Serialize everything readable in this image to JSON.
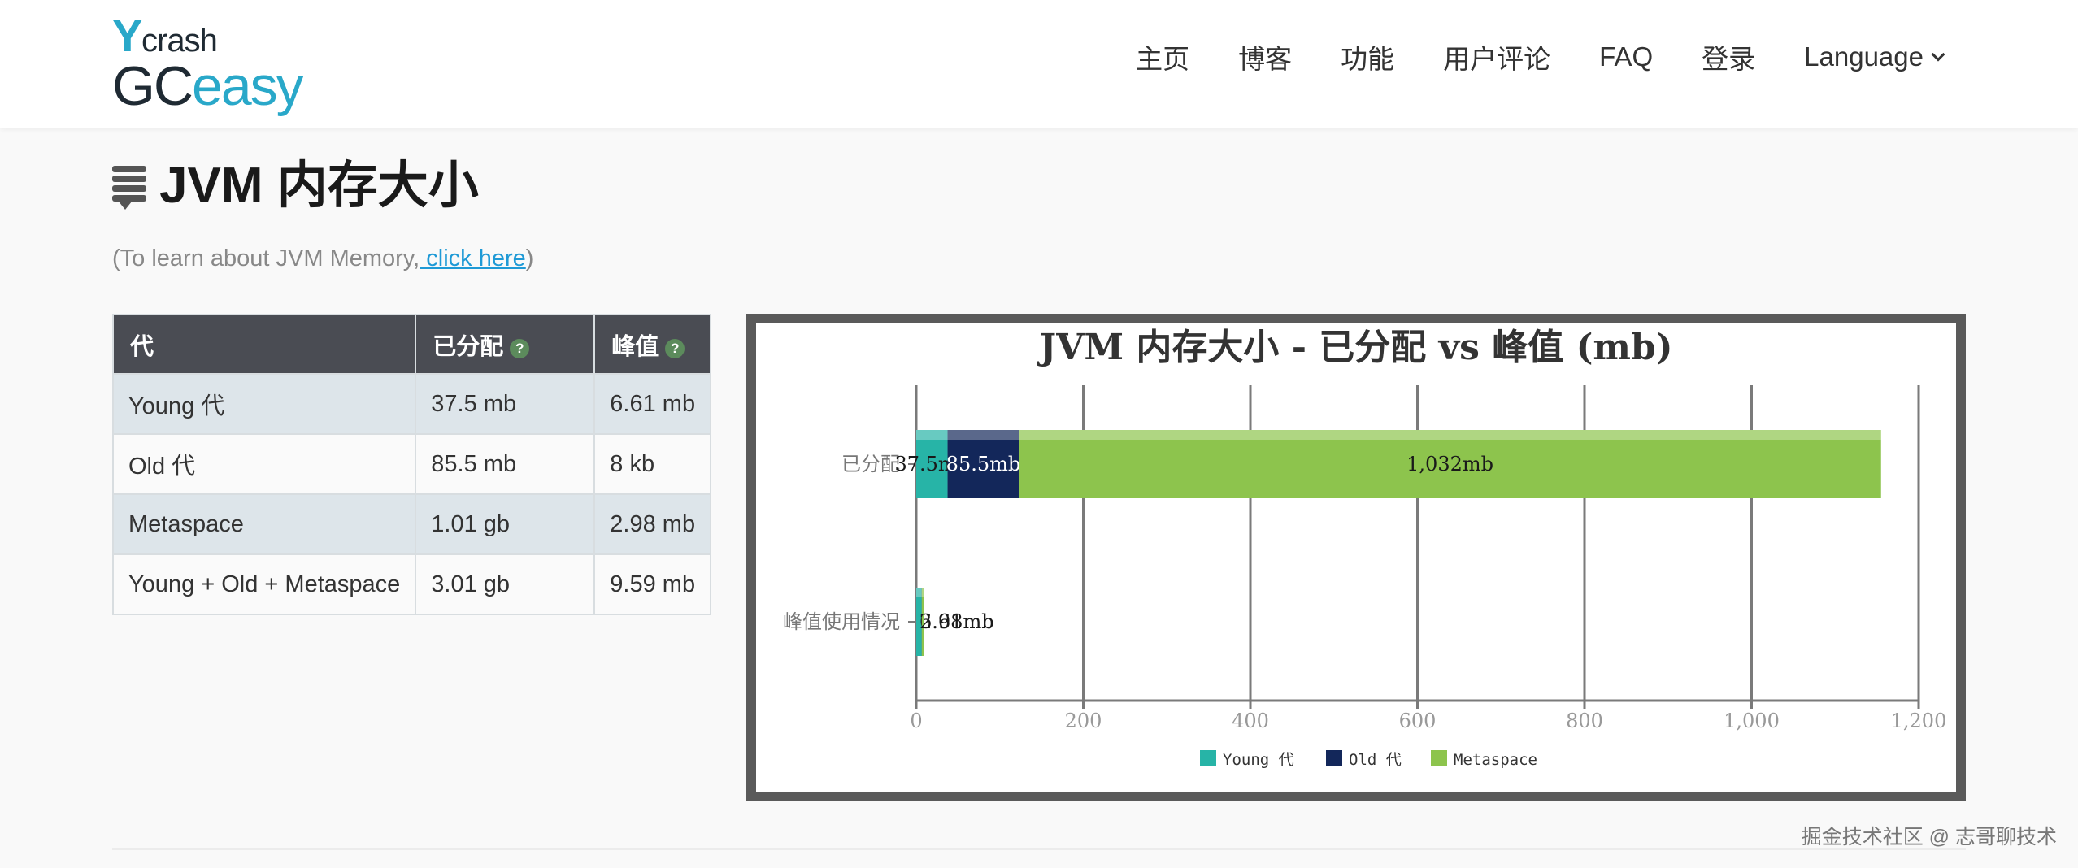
{
  "header": {
    "logo_y": "Y",
    "logo_crash": "crash",
    "logo_gc": "GC",
    "logo_easy": "easy",
    "nav": [
      "主页",
      "博客",
      "功能",
      "用户评论",
      "FAQ",
      "登录"
    ],
    "language": "Language"
  },
  "section": {
    "title": "JVM 内存大小",
    "learn_prefix": "(To learn about JVM Memory,",
    "learn_link": " click here",
    "learn_suffix": ")"
  },
  "table": {
    "headers": [
      "代",
      "已分配",
      "峰值"
    ],
    "help_glyph": "?",
    "rows": [
      [
        "Young 代",
        "37.5 mb",
        "6.61 mb"
      ],
      [
        "Old 代",
        "85.5 mb",
        "8 kb"
      ],
      [
        "Metaspace",
        "1.01 gb",
        "2.98 mb"
      ],
      [
        "Young + Old + Metaspace",
        "3.01 gb",
        "9.59 mb"
      ]
    ]
  },
  "chart_data": {
    "type": "bar",
    "orientation": "horizontal",
    "stacked": true,
    "title": "JVM 内存大小 - 已分配 vs 峰值 (mb)",
    "categories": [
      "已分配",
      "峰值使用情况"
    ],
    "series": [
      {
        "name": "Young 代",
        "color": "#27b4a7",
        "values": [
          37.5,
          6.61
        ],
        "labels": [
          "37.5mb",
          "6.61mb"
        ]
      },
      {
        "name": "Old 代",
        "color": "#13275a",
        "values": [
          85.5,
          0.008
        ],
        "labels": [
          "85.5mb",
          ""
        ]
      },
      {
        "name": "Metaspace",
        "color": "#8dc44d",
        "values": [
          1032,
          2.98
        ],
        "labels": [
          "1,032mb",
          "2.98mb"
        ]
      }
    ],
    "xlim": [
      0,
      1200
    ],
    "xticks": [
      0,
      200,
      400,
      600,
      800,
      1000,
      1200
    ],
    "xtick_labels": [
      "0",
      "200",
      "400",
      "600",
      "800",
      "1,000",
      "1,200"
    ],
    "grid": true,
    "legend_position": "bottom"
  },
  "watermark": "掘金技术社区 @ 志哥聊技术"
}
